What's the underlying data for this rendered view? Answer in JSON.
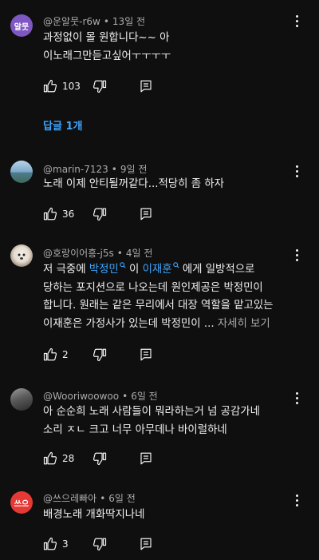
{
  "comments": [
    {
      "avatar_text": "알뭇",
      "avatar_color": "#7e57c2",
      "author": "@운알뭇-r6w",
      "time": "13일 전",
      "lines": [
        "과정없이 몰 원합니다~~  아",
        "이노래그만듣고싶어ㅜㅜㅜㅜ"
      ],
      "likes": "103",
      "replies": "답글 1개"
    },
    {
      "avatar_text": "",
      "avatar_color": "#5f8fb0",
      "author": "@marin-7123",
      "time": "9일 전",
      "lines": [
        "노래 이제 안티될꺼같다...적당히 좀 하자"
      ],
      "likes": "36"
    },
    {
      "avatar_text": "",
      "avatar_color": "#d9d2c7",
      "author": "@호랑이어흥-j5s",
      "time": "4일 전",
      "line1_prefix": "저 극중에 ",
      "mention1": "박정민",
      "line1_mid": " 이 ",
      "mention2": "이재훈",
      "line1_suffix": " 에게 일방적으로",
      "lines_rest": [
        "당하는 포지션으로 나오는데 원인제공은 박정민이",
        "합니다. 원래는 같은 무리에서 대장 역할을 맡고있는"
      ],
      "line4_text": "이재훈은 가정사가 있는데 박정민이 ... ",
      "read_more": "자세히 보기",
      "likes": "2"
    },
    {
      "avatar_text": "",
      "avatar_color": "#6b6b6b",
      "author": "@Wooriwoowoo",
      "time": "6일 전",
      "lines": [
        "아 순순희 노래 사람들이 뭐라하는거 넘 공감가네",
        "소리 ㅈㄴ 크고 너무 아무데나 바이럴하네"
      ],
      "likes": "28"
    },
    {
      "avatar_text": "쓰으",
      "avatar_color": "#e53935",
      "author": "@쓰으레빠아",
      "time": "6일 전",
      "lines": [
        "배경노래 개화딱지나네"
      ],
      "likes": "3"
    }
  ],
  "icons": {
    "like": "thumb-up-icon",
    "dislike": "thumb-down-icon",
    "reply": "reply-icon",
    "more": "more-vert-icon"
  }
}
